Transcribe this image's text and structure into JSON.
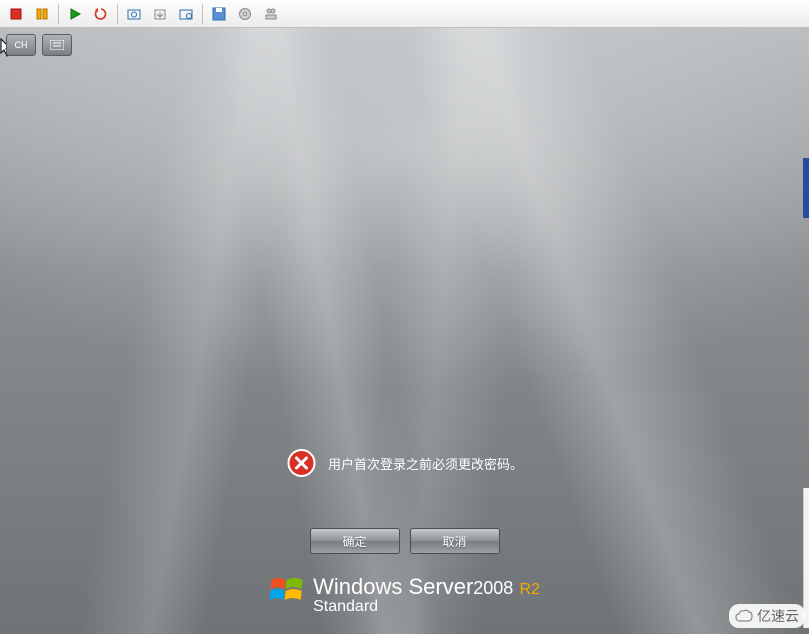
{
  "toolbar": {
    "icons": [
      "stop",
      "pause",
      "play",
      "refresh",
      "snapshot",
      "revert",
      "settings",
      "floppy",
      "cdrom",
      "network"
    ]
  },
  "vm_buttons": {
    "lang": "CH"
  },
  "message": "用户首次登录之前必须更改密码。",
  "buttons": {
    "ok": "确定",
    "cancel": "取消"
  },
  "brand": {
    "name_prefix": "Windows",
    "name_server": "Server",
    "year": "2008",
    "r2": "R2",
    "edition": "Standard"
  },
  "watermark": "亿速云"
}
